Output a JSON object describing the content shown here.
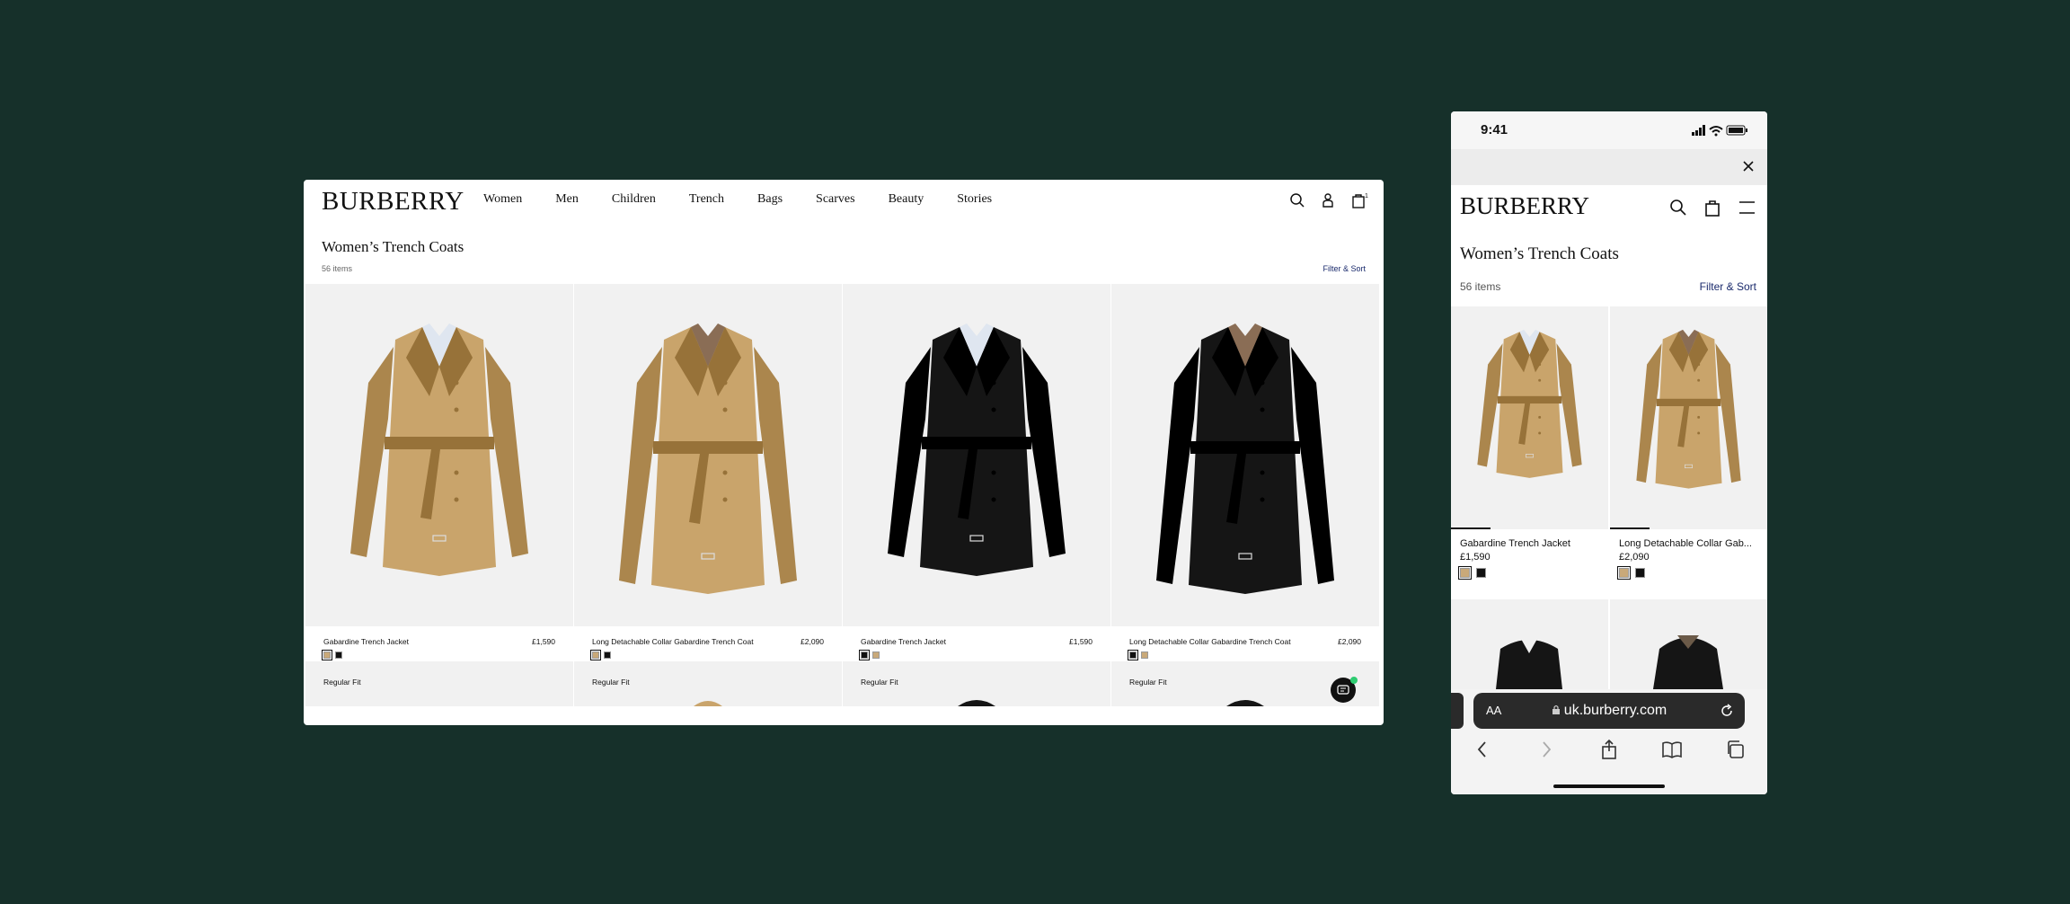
{
  "desktop": {
    "logo": "BURBERRY",
    "nav": [
      "Women",
      "Men",
      "Children",
      "Trench",
      "Bags",
      "Scarves",
      "Beauty",
      "Stories"
    ],
    "bag_count": "1",
    "page_title": "Women’s Trench Coats",
    "item_count": "56 items",
    "filter_label": "Filter & Sort",
    "products": [
      {
        "name": "Gabardine Trench Jacket",
        "price": "£1,590",
        "coat_color": "#c9a46b",
        "swatches": [
          "#c9a979",
          "#111111"
        ],
        "selected_swatch": 0
      },
      {
        "name": "Long Detachable Collar Gabardine Trench Coat",
        "price": "£2,090",
        "coat_color": "#c9a46b",
        "swatches": [
          "#c9a979",
          "#111111"
        ],
        "selected_swatch": 0
      },
      {
        "name": "Gabardine Trench Jacket",
        "price": "£1,590",
        "coat_color": "#151515",
        "swatches": [
          "#111111",
          "#c9a979"
        ],
        "selected_swatch": 0
      },
      {
        "name": "Long Detachable Collar Gabardine Trench Coat",
        "price": "£2,090",
        "coat_color": "#151515",
        "swatches": [
          "#111111",
          "#c9a979"
        ],
        "selected_swatch": 0
      }
    ],
    "row2_label": "Regular Fit"
  },
  "mobile": {
    "time": "9:41",
    "logo": "BURBERRY",
    "page_title": "Women’s Trench Coats",
    "item_count": "56 items",
    "filter_label": "Filter & Sort",
    "products": [
      {
        "name": "Gabardine Trench Jacket",
        "price": "£1,590",
        "coat_color": "#c9a46b"
      },
      {
        "name": "Long Detachable Collar Gab...",
        "price": "£2,090",
        "coat_color": "#c9a46b"
      }
    ],
    "aa_label": "AA",
    "url": "uk.burberry.com"
  },
  "colors": {
    "background": "#16302a",
    "link": "#1a2a6c",
    "chat_badge": "#2ecc71"
  }
}
